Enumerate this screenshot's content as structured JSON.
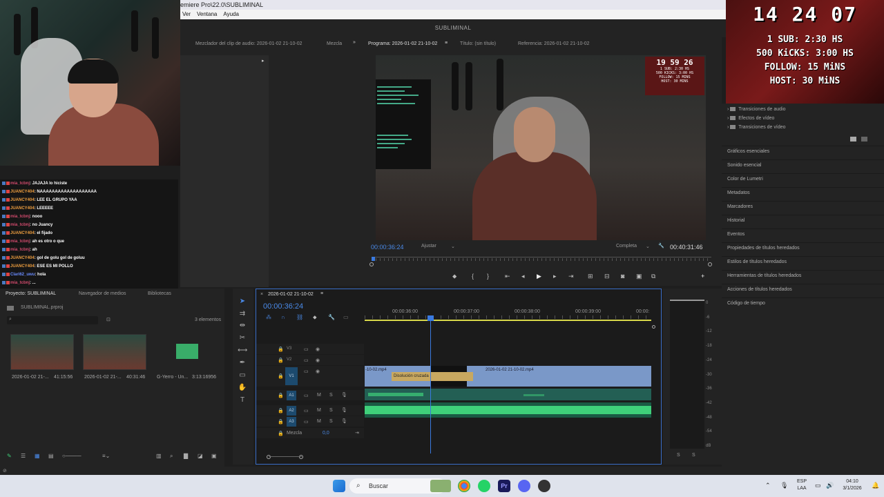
{
  "window": {
    "title": "emiere Pro\\22.0\\SUBLIMINAL",
    "menu": [
      "Ver",
      "Ventana",
      "Ayuda"
    ],
    "workspace": "SUBLIMINAL"
  },
  "overlay": {
    "time": "14 24 07",
    "lines": [
      "1 SUB: 2:30 HS",
      "500 KiCKS: 3:00 HS",
      "FOLLOW: 15 MiNS",
      "HOST: 30 MiNS"
    ]
  },
  "preview_overlay": {
    "time": "19 59 26",
    "lines": [
      "1 SUB: 2:30 HS",
      "500 KICKS: 3:00 HS",
      "FOLLOW: 15 MINS",
      "HOST: 30 MINS"
    ]
  },
  "chat": [
    {
      "user": "mia_tcbnj",
      "text": ": JAJAJA lo hiciste",
      "cls": "u1"
    },
    {
      "user": "JUANCY404",
      "text": ": NAAAAAAAAAAAAAAAAAAA",
      "cls": "u2"
    },
    {
      "user": "JUANCY404",
      "text": ": LEE EL GRUPO YAA",
      "cls": "u2"
    },
    {
      "user": "JUANCY404",
      "text": ": LEEEEE",
      "cls": "u2"
    },
    {
      "user": "mia_tcbnj",
      "text": ": nooo",
      "cls": "u1"
    },
    {
      "user": "mia_tcbnj",
      "text": ": no Juancy",
      "cls": "u1"
    },
    {
      "user": "JUANCY404",
      "text": ": el fijado",
      "cls": "u2"
    },
    {
      "user": "mia_tcbnj",
      "text": ": ah es otro o que",
      "cls": "u1"
    },
    {
      "user": "mia_tcbnj",
      "text": ": ah",
      "cls": "u1"
    },
    {
      "user": "JUANCY404",
      "text": ": gol de golu gol de goluu",
      "cls": "u2"
    },
    {
      "user": "JUANCY404",
      "text": ": ESE ES MI POLLO",
      "cls": "u2"
    },
    {
      "user": "Clari62_uwu",
      "text": ": hola",
      "cls": "u3"
    },
    {
      "user": "mia_tcbnj",
      "text": ": ...",
      "cls": "u1"
    }
  ],
  "audio_mixer": {
    "tab1": "Mezclador del clip de audio: 2026-01-02 21-10-02",
    "tab2": "Mezcla"
  },
  "program": {
    "tab_program": "Programa: 2026-01-02 21-10-02",
    "tab_title": "Título: (sin título)",
    "tab_reference": "Referencia: 2026-01-02 21-10-02",
    "timecode": "00:00:36:24",
    "fit": "Ajustar",
    "quality": "Completa",
    "duration": "00:40:31:46"
  },
  "effects": {
    "folders": [
      "Transiciones de audio",
      "Efectos de vídeo",
      "Transiciones de vídeo"
    ],
    "panels": [
      "Gráficos esenciales",
      "Sonido esencial",
      "Color de Lumetri",
      "Metadatos",
      "Marcadores",
      "Historial",
      "Eventos",
      "Propiedades de títulos heredados",
      "Estilos de títulos heredados",
      "Herramientas de títulos heredados",
      "Acciones de títulos heredados",
      "Código de tiempo"
    ]
  },
  "project": {
    "tab_project": "Proyecto: SUBLIMINAL",
    "tab_media": "Navegador de medios",
    "tab_libraries": "Bibliotecas",
    "file": "SUBLIMINAL.prproj",
    "count": "3 elementos",
    "items": [
      {
        "name": "2026-01-02 21-...",
        "duration": "41:15:56"
      },
      {
        "name": "2026-01-02 21-...",
        "duration": "40:31:46"
      },
      {
        "name": "G-Yerro - Un...",
        "duration": "3:13:16956"
      }
    ]
  },
  "timeline": {
    "sequence": "2026-01-02 21-10-02",
    "timecode": "00:00:36:24",
    "ruler": [
      "00:00:36:00",
      "00:00:37:00",
      "00:00:38:00",
      "00:00:39:00",
      "00:00:"
    ],
    "tracks_video": [
      "V3",
      "V2",
      "V1"
    ],
    "tracks_audio": [
      "A1",
      "A2",
      "A3"
    ],
    "mix_label": "Mezcla",
    "mix_value": "0,0",
    "clip_left": "-10-02.mp4",
    "clip_right": "2026-01-02 21-10-02.mp4",
    "transition": "Disolución cruzada"
  },
  "meters": {
    "ticks": [
      "0",
      "-6",
      "-12",
      "-18",
      "-24",
      "-30",
      "-36",
      "-42",
      "-48",
      "-54",
      "dB"
    ],
    "solo": [
      "S",
      "S"
    ]
  },
  "taskbar": {
    "search": "Buscar",
    "lang": "ESP",
    "lang2": "LAA",
    "time": "04:10",
    "date": "3/1/2026"
  },
  "colors": {
    "accent": "#3a7ae0",
    "video_clip": "#7a98c8",
    "audio_wave": "#3fd07a"
  }
}
